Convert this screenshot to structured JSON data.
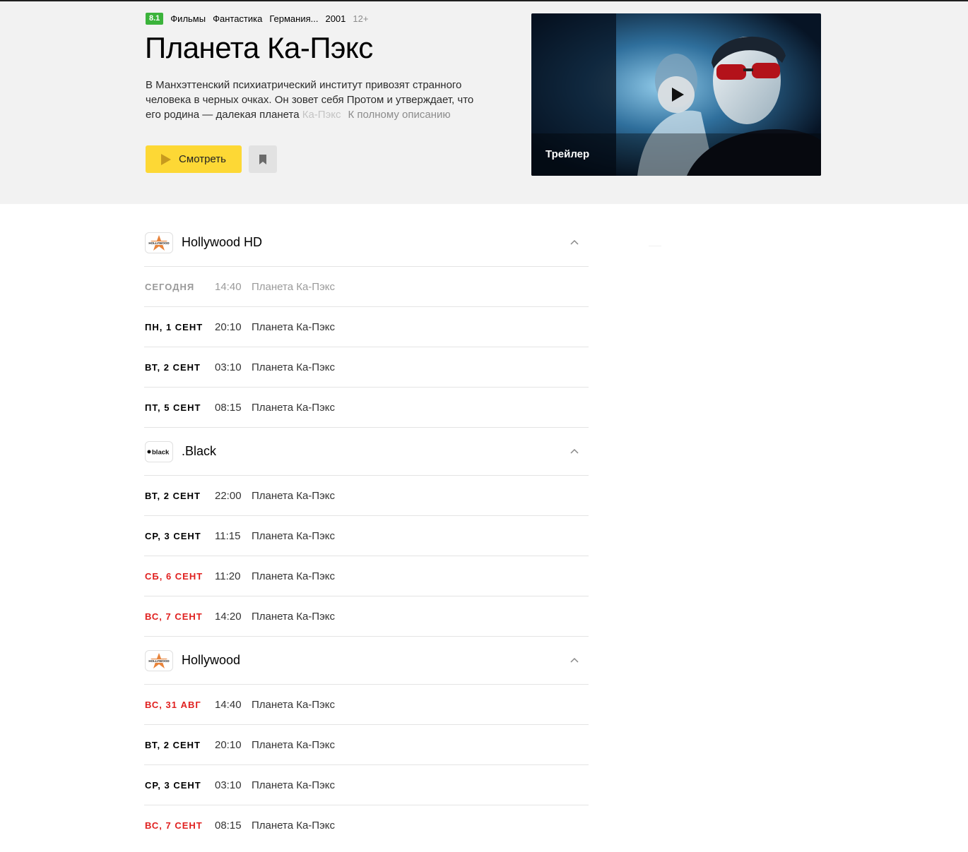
{
  "hero": {
    "rating": "8.1",
    "meta": [
      "Фильмы",
      "Фантастика",
      "Германия...",
      "2001"
    ],
    "age": "12+",
    "title": "Планета Ка-Пэкс",
    "description_main": "В Манхэттенский психиатрический институт привозят странного человека в черных очках. Он зовет себя Протом и утверждает, что его родина — далекая планета ",
    "description_fade": "Ка-Пэкс",
    "more_link": "К полному описанию",
    "watch_label": "Смотреть",
    "trailer_label": "Трейлер"
  },
  "colors": {
    "accent": "#fdd835",
    "rating": "#3bb33b",
    "weekend": "#e0201f"
  },
  "icons": {
    "play": "play-icon",
    "bookmark": "bookmark-icon",
    "collapse": "chevron-up-icon"
  },
  "schedule": [
    {
      "channel": "Hollywood HD",
      "logo_text": "HOLLYWOOD",
      "rows": [
        {
          "day": "СЕГОДНЯ",
          "time": "14:40",
          "program": "Планета Ка-Пэкс",
          "state": "past"
        },
        {
          "day": "ПН, 1 СЕНТ",
          "time": "20:10",
          "program": "Планета Ка-Пэкс",
          "state": "normal"
        },
        {
          "day": "ВТ, 2 СЕНТ",
          "time": "03:10",
          "program": "Планета Ка-Пэкс",
          "state": "normal"
        },
        {
          "day": "ПТ, 5 СЕНТ",
          "time": "08:15",
          "program": "Планета Ка-Пэкс",
          "state": "normal"
        }
      ]
    },
    {
      "channel": ".Black",
      "logo_text": "black",
      "rows": [
        {
          "day": "ВТ, 2 СЕНТ",
          "time": "22:00",
          "program": "Планета Ка-Пэкс",
          "state": "normal"
        },
        {
          "day": "СР, 3 СЕНТ",
          "time": "11:15",
          "program": "Планета Ка-Пэкс",
          "state": "normal"
        },
        {
          "day": "СБ, 6 СЕНТ",
          "time": "11:20",
          "program": "Планета Ка-Пэкс",
          "state": "weekend"
        },
        {
          "day": "ВС, 7 СЕНТ",
          "time": "14:20",
          "program": "Планета Ка-Пэкс",
          "state": "weekend"
        }
      ]
    },
    {
      "channel": "Hollywood",
      "logo_text": "HOLLYWOOD",
      "rows": [
        {
          "day": "ВС, 31 АВГ",
          "time": "14:40",
          "program": "Планета Ка-Пэкс",
          "state": "weekend"
        },
        {
          "day": "ВТ, 2 СЕНТ",
          "time": "20:10",
          "program": "Планета Ка-Пэкс",
          "state": "normal"
        },
        {
          "day": "СР, 3 СЕНТ",
          "time": "03:10",
          "program": "Планета Ка-Пэкс",
          "state": "normal"
        },
        {
          "day": "ВС, 7 СЕНТ",
          "time": "08:15",
          "program": "Планета Ка-Пэкс",
          "state": "weekend"
        }
      ]
    }
  ]
}
